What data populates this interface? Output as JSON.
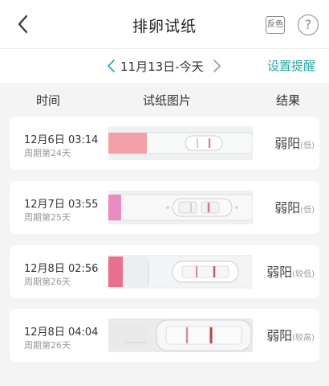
{
  "header": {
    "title": "排卵试纸",
    "invert_label": "反色",
    "help_label": "?"
  },
  "datebar": {
    "date": "11月13日-今天",
    "remind_label": "设置提醒"
  },
  "columns": {
    "time": "时间",
    "image": "试纸图片",
    "result": "结果"
  },
  "rows": [
    {
      "date": "12月6日 03:14",
      "cycle": "周期第24天",
      "result": "弱阳",
      "level": "(低)",
      "cap_color": "#f2a0a8",
      "line_intensity": 0.55
    },
    {
      "date": "12月7日 03:55",
      "cycle": "周期第25天",
      "result": "弱阳",
      "level": "(低)",
      "cap_color": "#e78bc0",
      "line_intensity": 0.6
    },
    {
      "date": "12月8日 02:56",
      "cycle": "周期第26天",
      "result": "弱阳",
      "level": "(较低)",
      "cap_color": "#e86f8e",
      "line_intensity": 0.75
    },
    {
      "date": "12月8日 04:04",
      "cycle": "周期第26天",
      "result": "弱阳",
      "level": "(较高)",
      "cap_color": "#e9e9ea",
      "line_intensity": 0.9
    }
  ],
  "colors": {
    "accent": "#27a7a7",
    "test_line": "#b3263a"
  },
  "icons": [
    "back-arrow-icon",
    "chevron-left-icon",
    "chevron-right-icon",
    "help-icon"
  ]
}
